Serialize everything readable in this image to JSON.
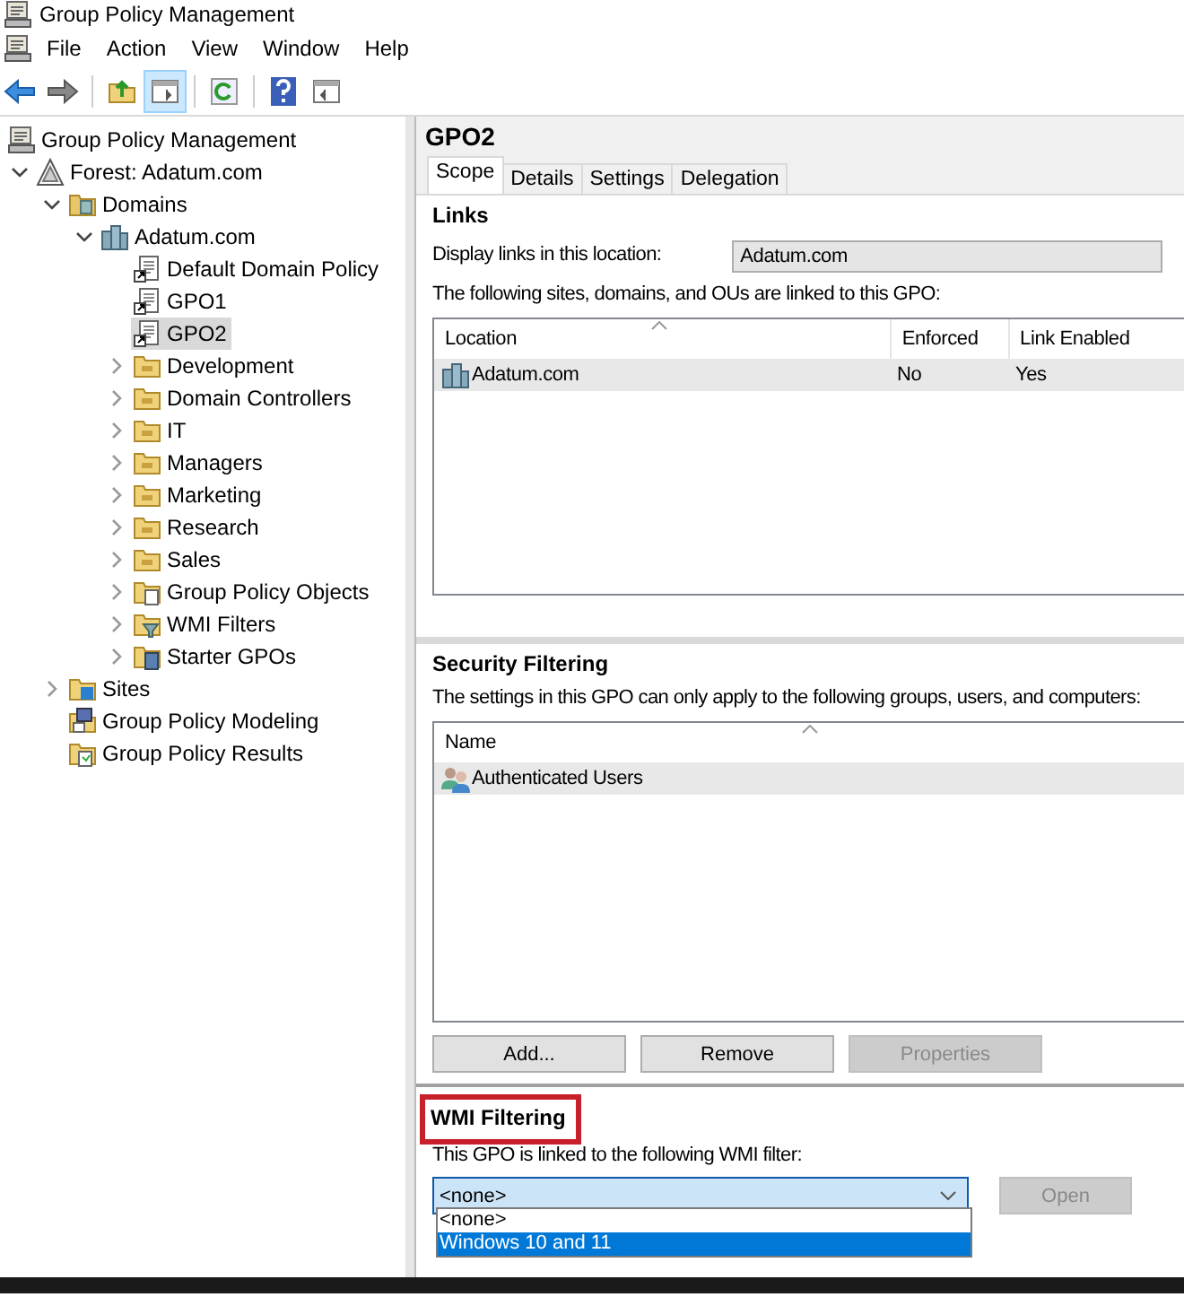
{
  "window": {
    "title": "Group Policy Management"
  },
  "menu": [
    "File",
    "Action",
    "View",
    "Window",
    "Help"
  ],
  "tree": [
    {
      "label": "Group Policy Management",
      "kind": "console",
      "selected": false,
      "children": [
        {
          "label": "Forest: Adatum.com",
          "kind": "forest",
          "expanded": true,
          "selected": false,
          "children": [
            {
              "label": "Domains",
              "kind": "domains",
              "expanded": true,
              "selected": false,
              "children": [
                {
                  "label": "Adatum.com",
                  "kind": "domain",
                  "expanded": true,
                  "selected": false,
                  "children": [
                    {
                      "label": "Default Domain Policy",
                      "kind": "gpo",
                      "selected": false
                    },
                    {
                      "label": "GPO1",
                      "kind": "gpo",
                      "selected": false
                    },
                    {
                      "label": "GPO2",
                      "kind": "gpo",
                      "selected": true
                    },
                    {
                      "label": "Development",
                      "kind": "ou",
                      "expanded": false,
                      "selected": false
                    },
                    {
                      "label": "Domain Controllers",
                      "kind": "ou",
                      "expanded": false,
                      "selected": false
                    },
                    {
                      "label": "IT",
                      "kind": "ou",
                      "expanded": false,
                      "selected": false
                    },
                    {
                      "label": "Managers",
                      "kind": "ou",
                      "expanded": false,
                      "selected": false
                    },
                    {
                      "label": "Marketing",
                      "kind": "ou",
                      "expanded": false,
                      "selected": false
                    },
                    {
                      "label": "Research",
                      "kind": "ou",
                      "expanded": false,
                      "selected": false
                    },
                    {
                      "label": "Sales",
                      "kind": "ou",
                      "expanded": false,
                      "selected": false
                    },
                    {
                      "label": "Group Policy Objects",
                      "kind": "gpo-folder",
                      "expanded": false,
                      "selected": false
                    },
                    {
                      "label": "WMI Filters",
                      "kind": "wmi-folder",
                      "expanded": false,
                      "selected": false
                    },
                    {
                      "label": "Starter GPOs",
                      "kind": "starter-folder",
                      "expanded": false,
                      "selected": false
                    }
                  ]
                }
              ]
            },
            {
              "label": "Sites",
              "kind": "sites",
              "expanded": false,
              "selected": false
            },
            {
              "label": "Group Policy Modeling",
              "kind": "modeling",
              "selected": false
            },
            {
              "label": "Group Policy Results",
              "kind": "results",
              "selected": false
            }
          ]
        }
      ]
    }
  ],
  "details": {
    "title": "GPO2",
    "tabs": [
      {
        "label": "Scope",
        "selected": true
      },
      {
        "label": "Details",
        "selected": false
      },
      {
        "label": "Settings",
        "selected": false
      },
      {
        "label": "Delegation",
        "selected": false
      }
    ],
    "links": {
      "heading": "Links",
      "location_label": "Display links in this location:",
      "location_value": "Adatum.com",
      "caption": "The following sites, domains, and OUs are linked to this GPO:",
      "columns": [
        "Location",
        "Enforced",
        "Link Enabled"
      ],
      "rows": [
        {
          "cells": [
            "Adatum.com",
            "No",
            "Yes"
          ],
          "selected": true
        }
      ]
    },
    "security": {
      "heading": "Security Filtering",
      "caption": "The settings in this GPO can only apply to the following groups, users, and computers:",
      "columns": [
        "Name"
      ],
      "rows": [
        {
          "cells": [
            "Authenticated Users"
          ],
          "selected": true
        }
      ],
      "buttons": [
        {
          "label": "Add...",
          "disabled": false
        },
        {
          "label": "Remove",
          "disabled": false
        },
        {
          "label": "Properties",
          "disabled": true
        }
      ]
    },
    "wmi": {
      "heading": "WMI Filtering",
      "highlighted": true,
      "caption": "This GPO is linked to the following WMI filter:",
      "value": "<none>",
      "expanded": true,
      "options": [
        {
          "label": "<none>",
          "highlighted": false
        },
        {
          "label": "Windows 10 and 11",
          "highlighted": true
        }
      ],
      "open_button": {
        "label": "Open",
        "disabled": true
      }
    }
  }
}
